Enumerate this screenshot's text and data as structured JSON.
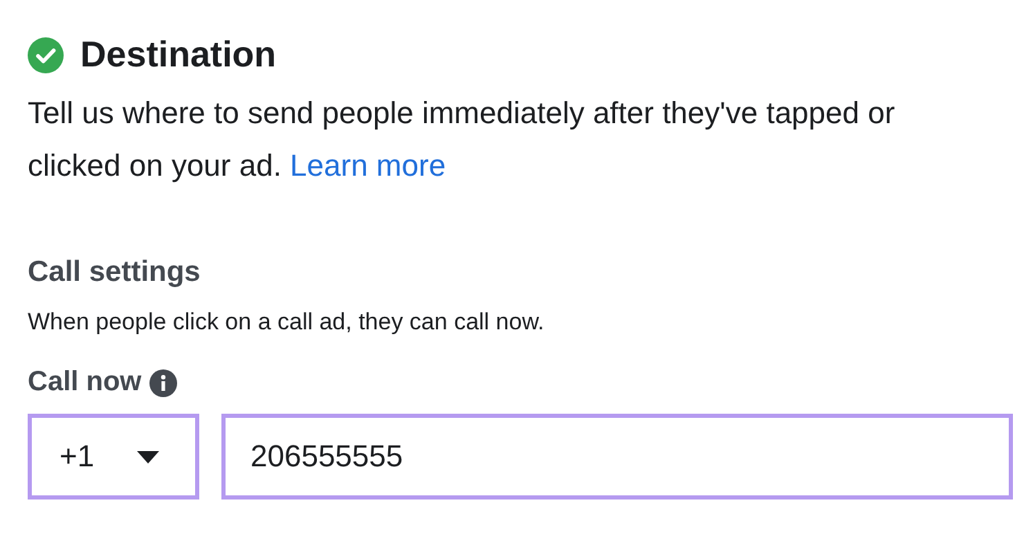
{
  "section": {
    "title": "Destination",
    "completed": true,
    "description": "Tell us where to send people immediately after they've tapped or clicked on your ad.",
    "link": "Learn more"
  },
  "call_settings": {
    "title": "Call settings",
    "description": "When people click on a call ad, they can call now."
  },
  "call_now": {
    "label": "Call now",
    "country_code": {
      "value": "+1",
      "highlighted": true
    },
    "phone": {
      "value": "206555555",
      "highlighted": true
    }
  }
}
